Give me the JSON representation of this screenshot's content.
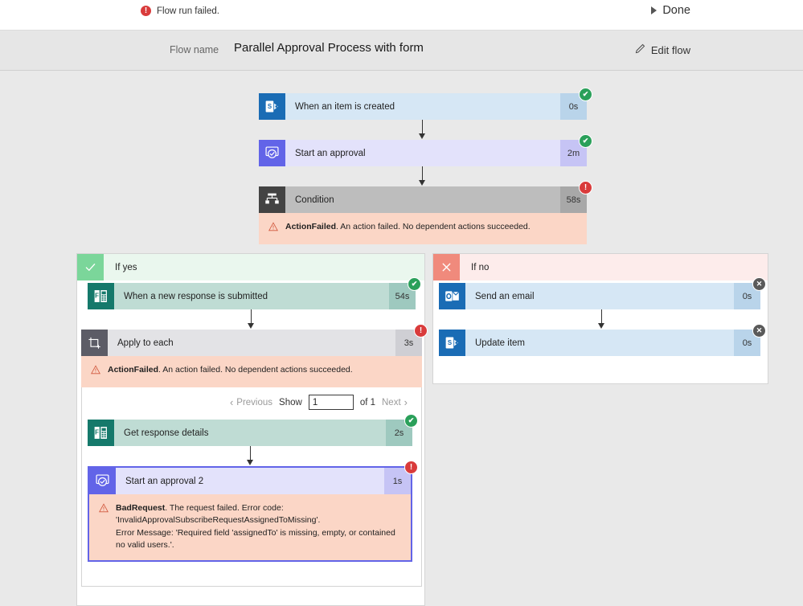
{
  "topbar": {
    "status_icon": "error-circle-icon",
    "status_text": "Flow run failed.",
    "done_label": "Done",
    "done_icon": "play-triangle-icon"
  },
  "namebar": {
    "flow_name_label": "Flow name",
    "flow_name_value": "Parallel Approval Process with form",
    "edit_flow_label": "Edit flow",
    "edit_flow_icon": "pencil-icon"
  },
  "colors": {
    "accent_blue": "#0f6cbd",
    "success_green": "#2aa05a",
    "error_red": "#d93b3b",
    "skipped_gray": "#5a5a5a",
    "error_banner_bg": "#fbd6c6",
    "yes_branch_green": "#7bd69a",
    "no_branch_red": "#f08a7c",
    "approval_purple": "#6264e8",
    "sharepoint_blue": "#1a6cb5",
    "forms_teal": "#15796b"
  },
  "flow": {
    "trigger": {
      "title": "When an item is created",
      "duration": "0s",
      "icon": "sharepoint-icon",
      "status": "succeeded",
      "badge_glyph": "✔"
    },
    "approval": {
      "title": "Start an approval",
      "duration": "2m",
      "icon": "approval-icon",
      "status": "succeeded",
      "badge_glyph": "✔"
    },
    "condition": {
      "title": "Condition",
      "duration": "58s",
      "icon": "condition-icon",
      "status": "failed",
      "badge_glyph": "!",
      "error_code": "ActionFailed",
      "error_text": ". An action failed. No dependent actions succeeded."
    }
  },
  "branches": {
    "yes": {
      "label": "If yes",
      "icon": "check-icon",
      "nodes": [
        {
          "title": "When a new response is submitted",
          "duration": "54s",
          "icon": "forms-icon",
          "status": "succeeded",
          "badge_glyph": "✔"
        },
        {
          "title": "Apply to each",
          "duration": "3s",
          "icon": "apply-to-each-icon",
          "status": "failed",
          "badge_glyph": "!",
          "error_code": "ActionFailed",
          "error_text": ". An action failed. No dependent actions succeeded."
        },
        {
          "title": "Get response details",
          "duration": "2s",
          "icon": "forms-icon",
          "status": "succeeded",
          "badge_glyph": "✔"
        },
        {
          "title": "Start an approval 2",
          "duration": "1s",
          "icon": "approval-icon",
          "status": "failed",
          "badge_glyph": "!",
          "error_code": "BadRequest",
          "error_text_line1": ". The request failed. Error code: 'InvalidApprovalSubscribeRequestAssignedToMissing'.",
          "error_text_line2": "Error Message: 'Required field 'assignedTo' is missing, empty, or contained no valid users.'."
        }
      ],
      "pager": {
        "previous_label": "Previous",
        "previous_chevron": "‹",
        "show_label": "Show",
        "page_value": "1",
        "of_label": "of 1",
        "next_label": "Next",
        "next_chevron": "›"
      }
    },
    "no": {
      "label": "If no",
      "icon": "x-icon",
      "nodes": [
        {
          "title": "Send an email",
          "duration": "0s",
          "icon": "outlook-icon",
          "status": "skipped",
          "badge_glyph": "✕"
        },
        {
          "title": "Update item",
          "duration": "0s",
          "icon": "sharepoint-icon",
          "status": "skipped",
          "badge_glyph": "✕"
        }
      ]
    }
  }
}
